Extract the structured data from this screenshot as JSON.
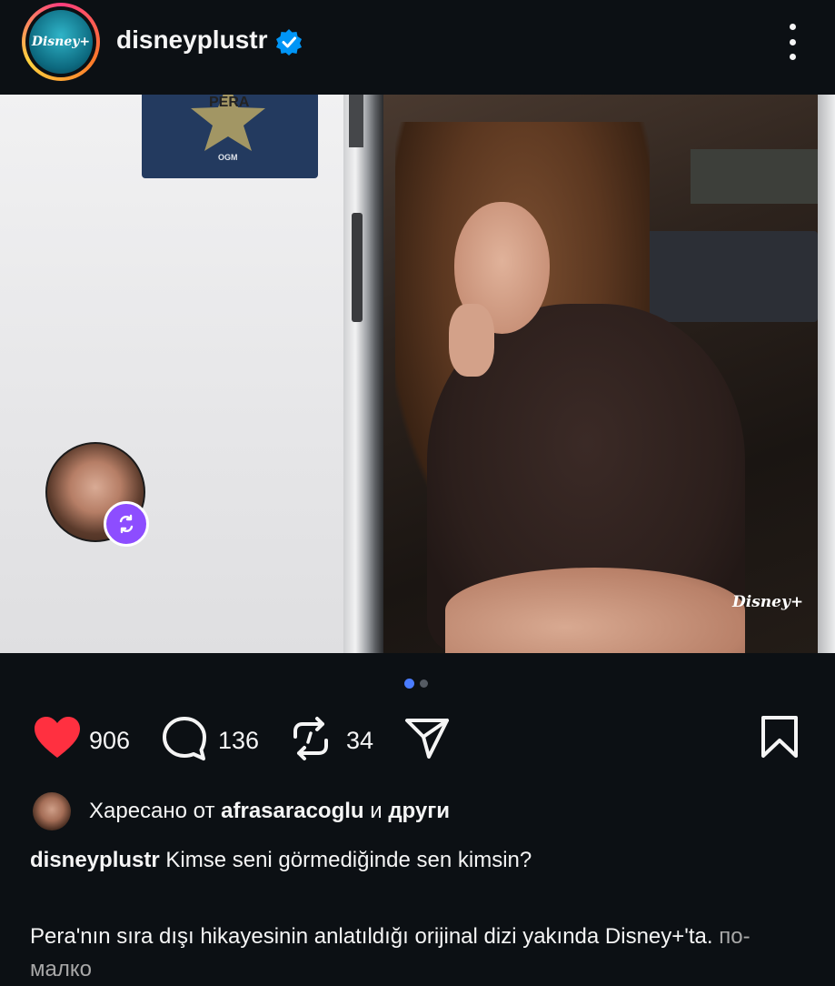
{
  "header": {
    "avatar_logo": "Disney+",
    "username": "disneyplustr",
    "verified": true,
    "more_icon": "more-vertical-icon"
  },
  "post": {
    "poster_title": "PERA",
    "poster_mark": "OGM",
    "watermark": "Disney+",
    "carousel": {
      "current": 1,
      "total": 2
    }
  },
  "actions": {
    "likes": "906",
    "comments": "136",
    "reposts": "34",
    "like_color": "#ff3040"
  },
  "liked_by": {
    "prefix": "Харесано от",
    "user": "afrasaracoglu",
    "conj": "и",
    "others": "други"
  },
  "caption": {
    "username": "disneyplustr",
    "line1": "Kimse seni görmediğinde sen kimsin?",
    "line2": "Pera'nın sıra dışı hikayesinin anlatıldığı orijinal dizi yakında Disney+'ta.",
    "more": "по-малко"
  },
  "colors": {
    "background": "#0c1014",
    "accent": "#4a7cff",
    "verified": "#0095f6",
    "story_badge": "#8d4dff"
  }
}
